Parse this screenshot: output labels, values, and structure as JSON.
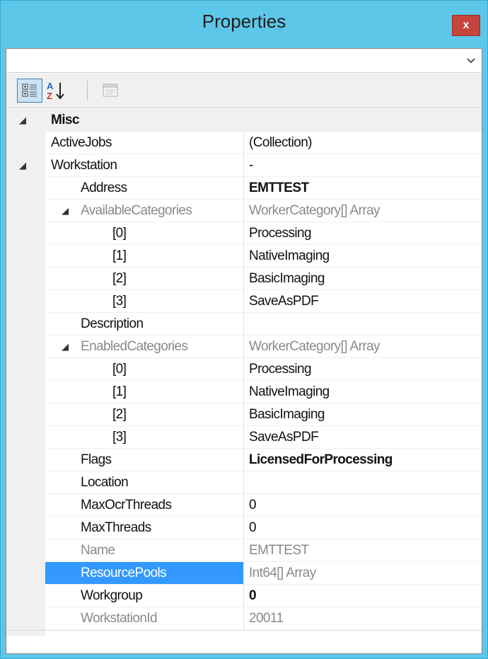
{
  "window": {
    "title": "Properties",
    "close_label": "x"
  },
  "combo": {
    "value": ""
  },
  "grid": {
    "rows": [
      {
        "name": "Misc",
        "value": "",
        "type": "category",
        "expanded": true
      },
      {
        "name": "ActiveJobs",
        "value": "(Collection)"
      },
      {
        "name": "Workstation",
        "value": "-",
        "expanded": true
      },
      {
        "name": "Address",
        "value": "EMTTEST",
        "bold": true
      },
      {
        "name": "AvailableCategories",
        "value": "WorkerCategory[] Array",
        "readonly": true,
        "expanded": true
      },
      {
        "name": "[0]",
        "value": "Processing"
      },
      {
        "name": "[1]",
        "value": "NativeImaging"
      },
      {
        "name": "[2]",
        "value": "BasicImaging"
      },
      {
        "name": "[3]",
        "value": "SaveAsPDF"
      },
      {
        "name": "Description",
        "value": ""
      },
      {
        "name": "EnabledCategories",
        "value": "WorkerCategory[] Array",
        "readonly": true,
        "expanded": true
      },
      {
        "name": "[0]",
        "value": "Processing"
      },
      {
        "name": "[1]",
        "value": "NativeImaging"
      },
      {
        "name": "[2]",
        "value": "BasicImaging"
      },
      {
        "name": "[3]",
        "value": "SaveAsPDF"
      },
      {
        "name": "Flags",
        "value": "LicensedForProcessing",
        "bold": true
      },
      {
        "name": "Location",
        "value": ""
      },
      {
        "name": "MaxOcrThreads",
        "value": "0"
      },
      {
        "name": "MaxThreads",
        "value": "0"
      },
      {
        "name": "Name",
        "value": "EMTTEST",
        "readonly": true
      },
      {
        "name": "ResourcePools",
        "value": "Int64[] Array",
        "readonly": true,
        "selected": true
      },
      {
        "name": "Workgroup",
        "value": "0",
        "bold": true
      },
      {
        "name": "WorkstationId",
        "value": "20011",
        "readonly": true
      }
    ]
  },
  "colors": {
    "titlebar": "#5dc7ea",
    "selection": "#3399ff",
    "close": "#c5443b"
  },
  "icons": {
    "categorized": "categorized-icon",
    "alphabetical": "sort-az-icon",
    "pages": "property-pages-icon",
    "expand": "collapse-triangle-icon"
  }
}
